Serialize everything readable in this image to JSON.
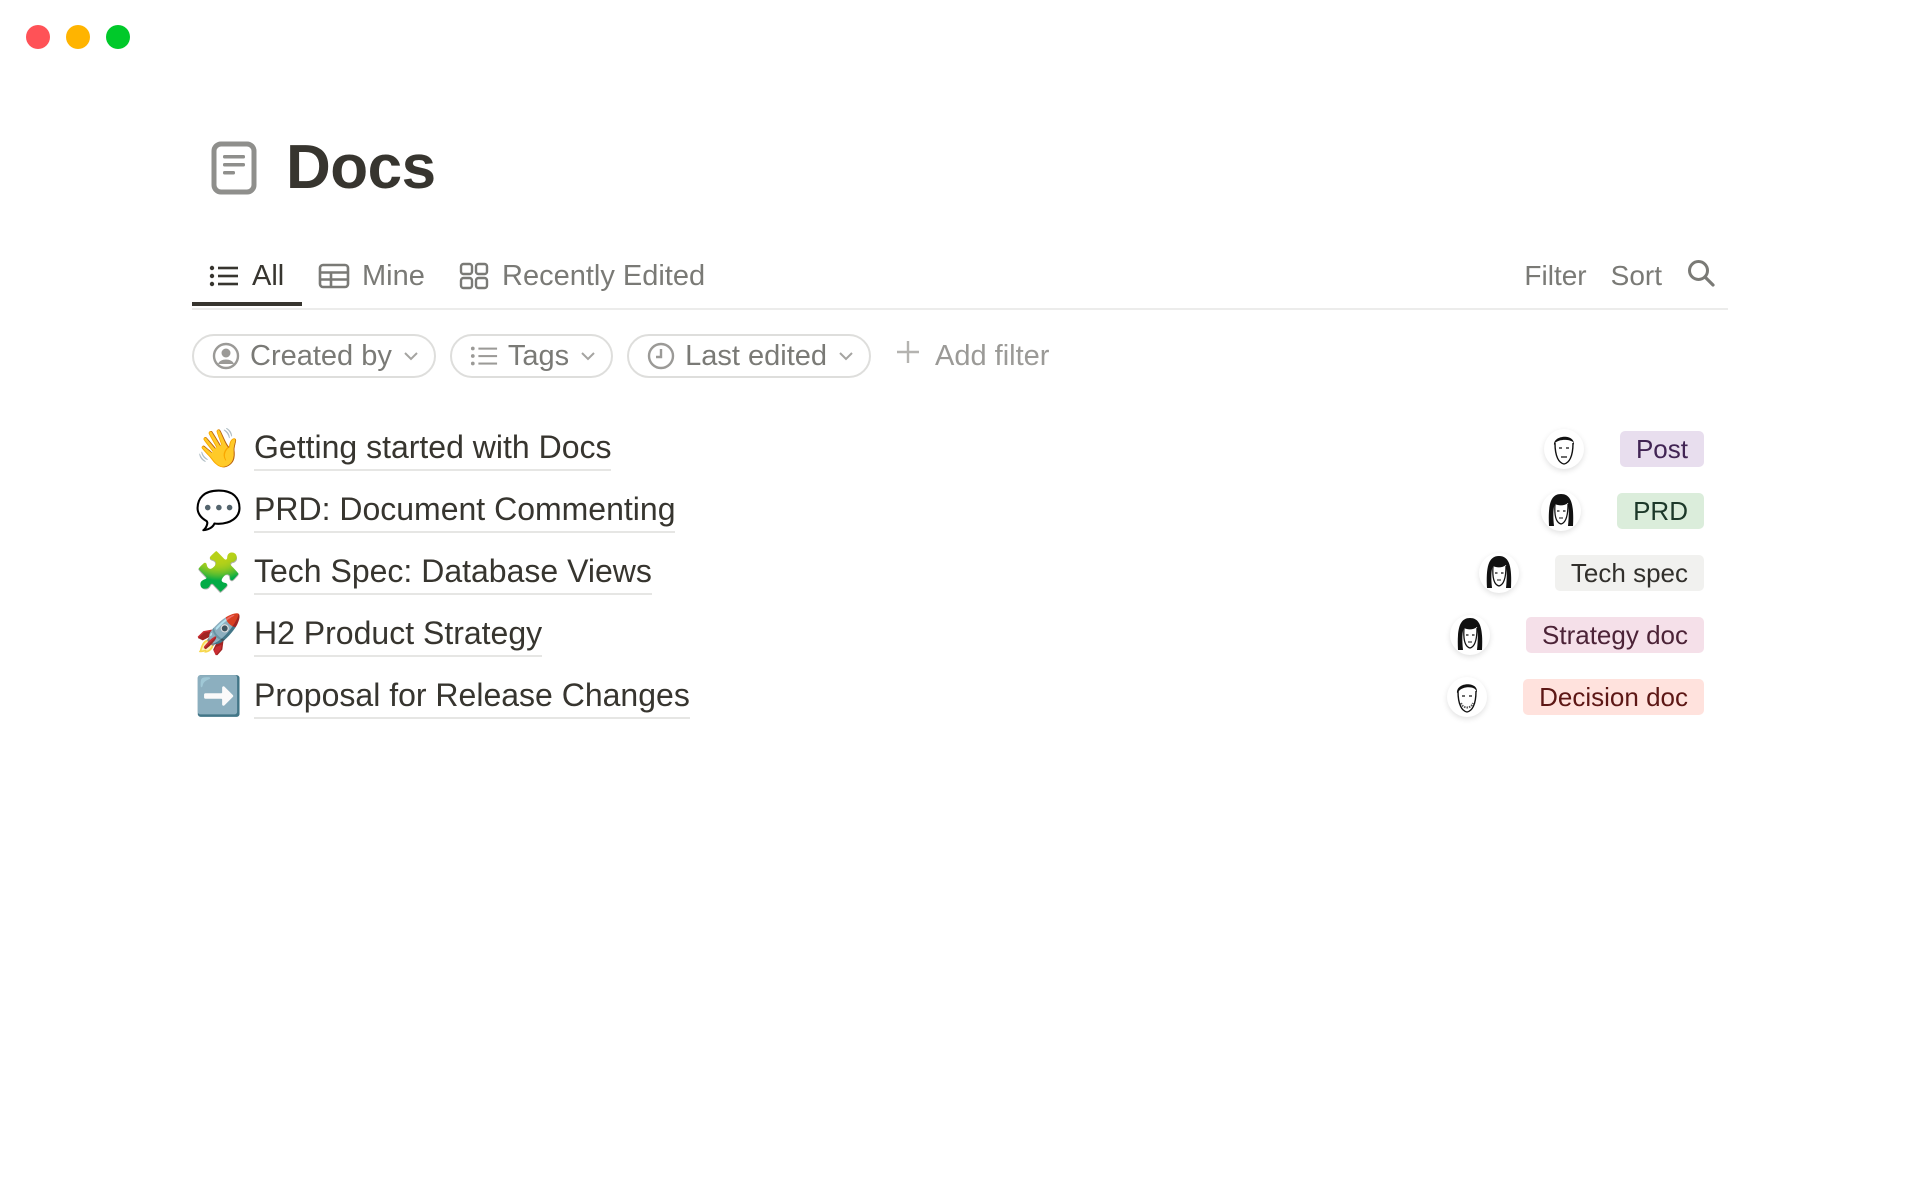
{
  "window": {
    "controls": [
      "close",
      "minimize",
      "zoom"
    ]
  },
  "header": {
    "icon": "page-doc-icon",
    "title": "Docs"
  },
  "tabs": [
    {
      "label": "All",
      "icon": "list-icon",
      "active": true
    },
    {
      "label": "Mine",
      "icon": "table-icon",
      "active": false
    },
    {
      "label": "Recently Edited",
      "icon": "gallery-icon",
      "active": false
    }
  ],
  "toolbar": {
    "filter_label": "Filter",
    "sort_label": "Sort",
    "search_icon": "search-icon"
  },
  "filters": [
    {
      "label": "Created by",
      "icon": "person-icon"
    },
    {
      "label": "Tags",
      "icon": "list-icon"
    },
    {
      "label": "Last edited",
      "icon": "clock-icon"
    }
  ],
  "add_filter_label": "Add filter",
  "docs": [
    {
      "emoji": "👋",
      "title": "Getting started with Docs",
      "tag": "Post",
      "tag_bg": "#e8deee",
      "tag_fg": "#412454",
      "avatar": "man-short-hair"
    },
    {
      "emoji": "💬",
      "title": "PRD: Document Commenting",
      "tag": "PRD",
      "tag_bg": "#dbeddb",
      "tag_fg": "#1c3829",
      "avatar": "woman-long-hair"
    },
    {
      "emoji": "🧩",
      "title": "Tech Spec: Database Views",
      "tag": "Tech spec",
      "tag_bg": "#f1f1ef",
      "tag_fg": "#32302c",
      "avatar": "woman-long-hair"
    },
    {
      "emoji": "🚀",
      "title": "H2 Product Strategy",
      "tag": "Strategy doc",
      "tag_bg": "#f5e0e9",
      "tag_fg": "#4c2337",
      "avatar": "woman-long-hair"
    },
    {
      "emoji": "➡️",
      "title": "Proposal for Release Changes",
      "tag": "Decision doc",
      "tag_bg": "#ffe2dd",
      "tag_fg": "#5d1715",
      "avatar": "man-beard"
    }
  ]
}
